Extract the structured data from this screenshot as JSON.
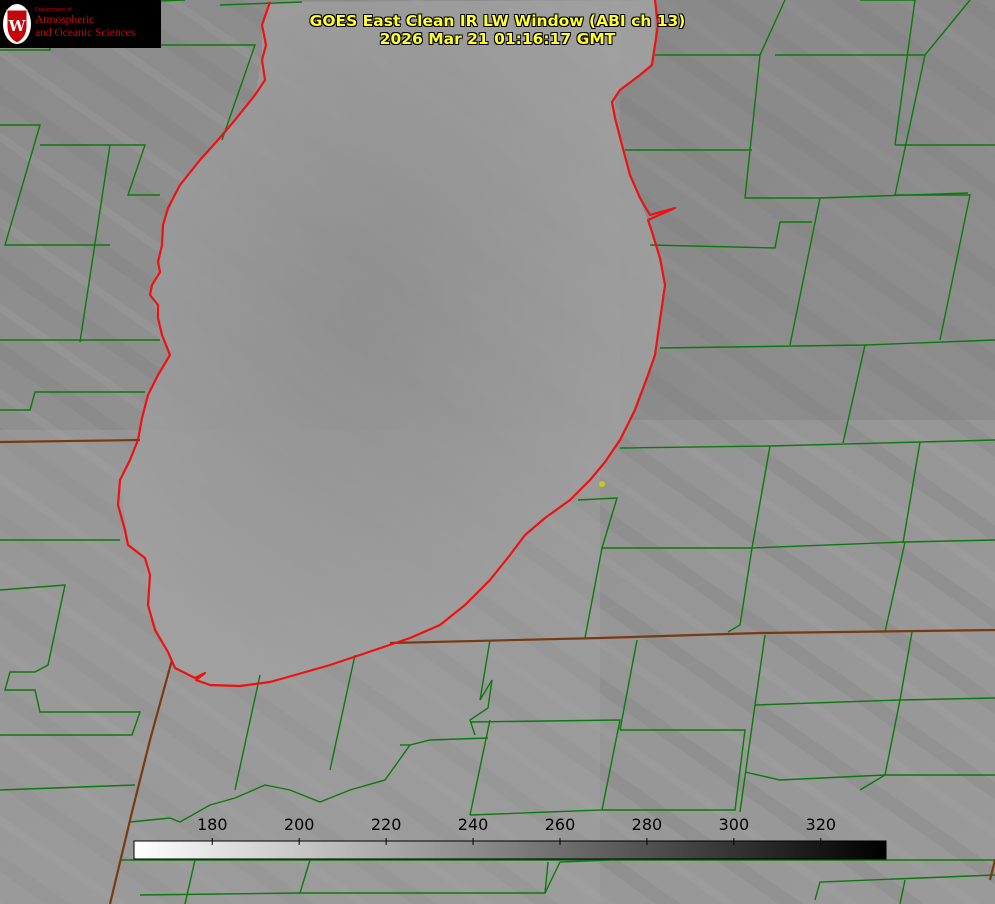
{
  "title": {
    "line1": "GOES East Clean IR LW Window (ABI ch 13)",
    "line2": "2026 Mar 21 01:16:17 GMT"
  },
  "logo": {
    "department": "Department of",
    "name_line1": "Atmospheric",
    "name_line2": "and Oceanic Sciences",
    "seal_letter": "W"
  },
  "colorbar": {
    "ticks": [
      "180",
      "200",
      "220",
      "240",
      "260",
      "280",
      "300",
      "320"
    ],
    "value_range": [
      162,
      335
    ],
    "gradient": [
      "#ffffff",
      "#000000"
    ]
  },
  "colors": {
    "lake_outline": "#ee1111",
    "county_lines": "#0b7a0b",
    "state_lines": "#7a3a10",
    "title_text": "#ffff33",
    "station_marker": "#c8c81e"
  }
}
